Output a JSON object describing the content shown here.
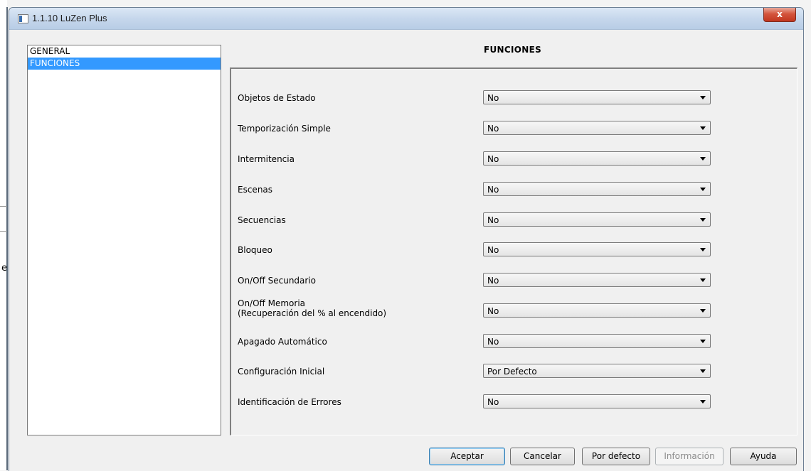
{
  "window": {
    "title": "1.1.10 LuZen Plus",
    "close_label": "x"
  },
  "nav": {
    "items": [
      {
        "label": "GENERAL",
        "selected": false
      },
      {
        "label": "FUNCIONES",
        "selected": true
      }
    ]
  },
  "section": {
    "title": "FUNCIONES"
  },
  "params": [
    {
      "label": "Objetos de Estado",
      "value": "No"
    },
    {
      "label": "Temporización Simple",
      "value": "No"
    },
    {
      "label": "Intermitencia",
      "value": "No"
    },
    {
      "label": "Escenas",
      "value": "No"
    },
    {
      "label": "Secuencias",
      "value": "No"
    },
    {
      "label": "Bloqueo",
      "value": "No"
    },
    {
      "label": "On/Off Secundario",
      "value": "No"
    },
    {
      "label": "On/Off Memoria",
      "label_line2": "(Recuperación del % al encendido)",
      "value": "No"
    },
    {
      "label": "Apagado Automático",
      "value": "No"
    },
    {
      "label": "Configuración Inicial",
      "value": "Por Defecto"
    },
    {
      "label": "Identificación de Errores",
      "value": "No"
    }
  ],
  "buttons": {
    "accept": "Aceptar",
    "cancel": "Cancelar",
    "defaults": "Por defecto",
    "info": "Información",
    "help": "Ayuda"
  },
  "background": {
    "edge_char": "e"
  }
}
